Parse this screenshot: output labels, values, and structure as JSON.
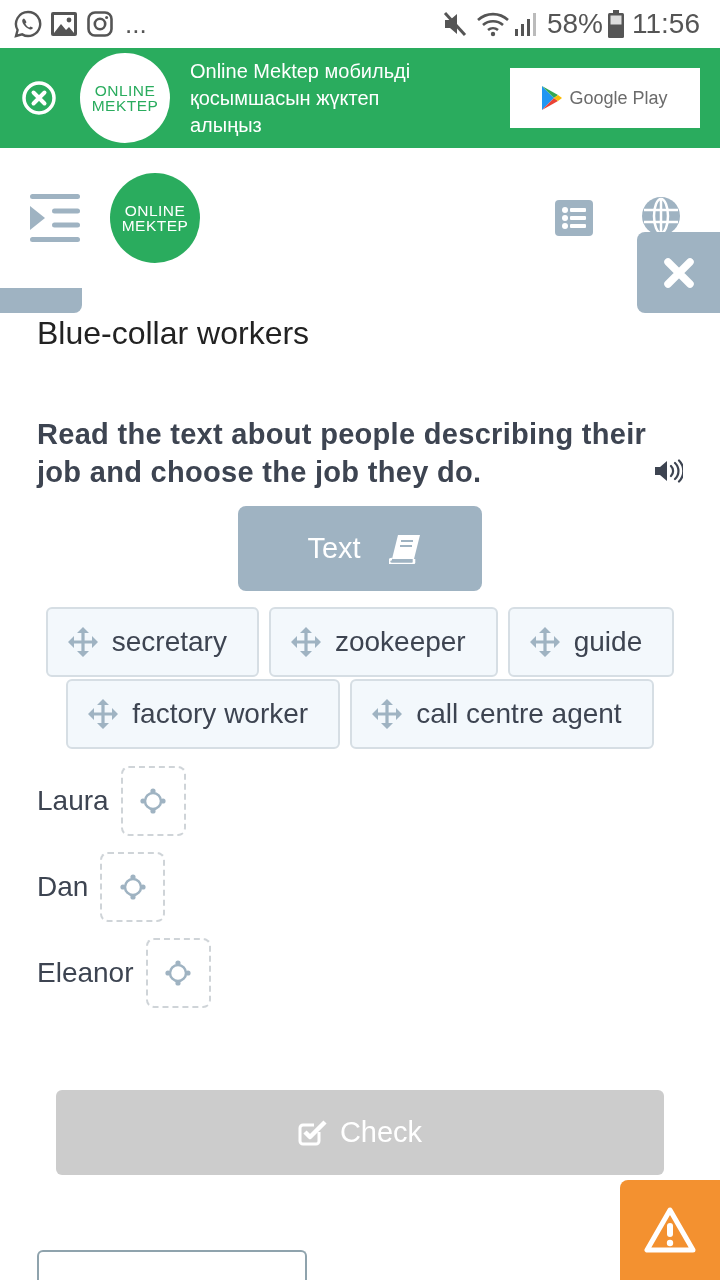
{
  "status_bar": {
    "overflow": "...",
    "battery": "58%",
    "time": "11:56"
  },
  "app_banner": {
    "message": "Online Mektep мобильді қосымшасын жүктеп алыңыз",
    "logo": [
      "ONLINE",
      "MEKTEP"
    ],
    "store_button": "Google Play"
  },
  "header": {
    "logo": [
      "ONLINE",
      "MEKTEP"
    ]
  },
  "task": {
    "title": "Blue-collar workers",
    "instruction": "Read the text about people describing their job and choose the job they do.",
    "text_button": "Text",
    "word_chips": [
      "secretary",
      "zookeeper",
      "guide",
      "factory worker",
      "call centre agent"
    ],
    "answers": [
      {
        "name": "Laura"
      },
      {
        "name": "Dan"
      },
      {
        "name": "Eleanor"
      }
    ],
    "check_button": {
      "label": "Check",
      "disabled": true
    }
  }
}
